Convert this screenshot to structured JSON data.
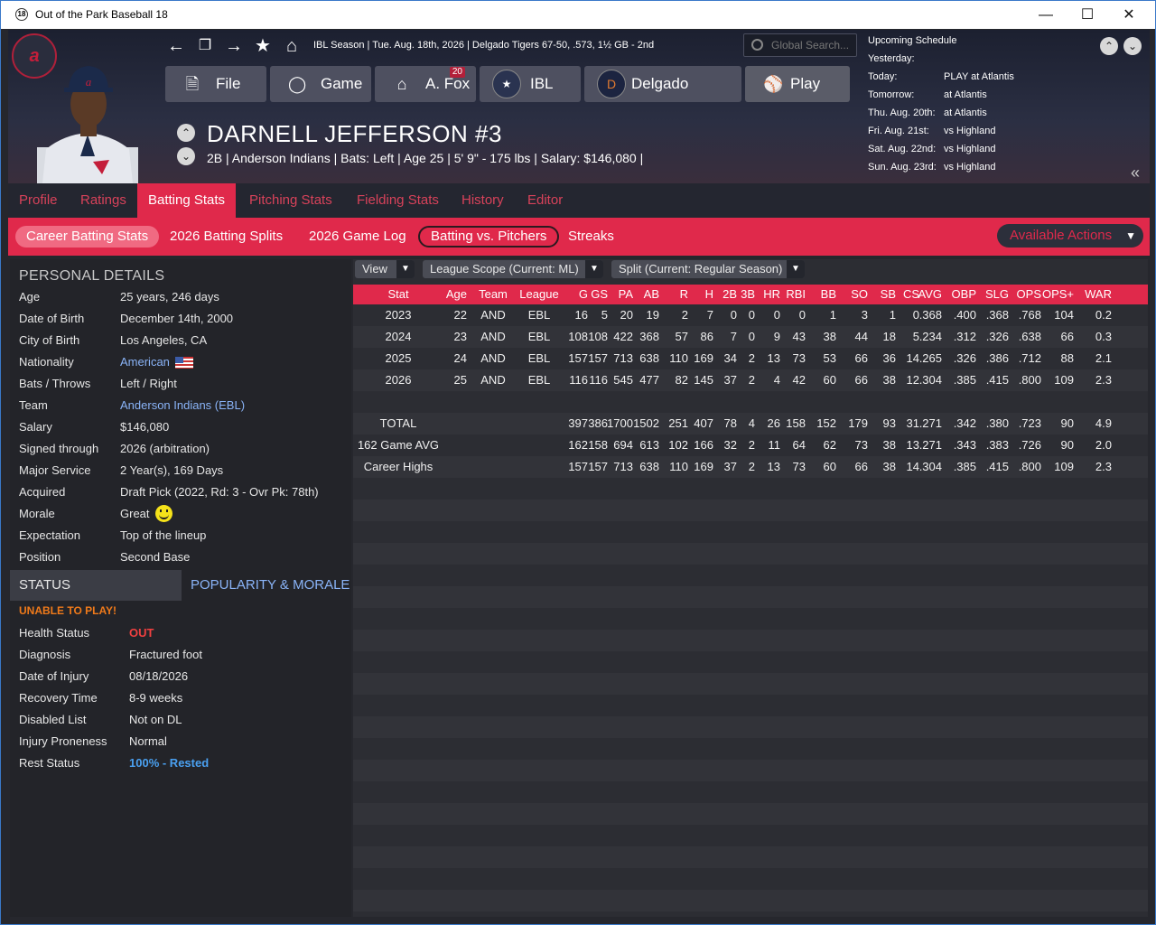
{
  "window": {
    "title": "Out of the Park Baseball 18",
    "icon_text": "18"
  },
  "header": {
    "team_logo": "a",
    "season_info": "IBL Season  |  Tue. Aug. 18th, 2026  |  Delgado Tigers   67-50, .573, 1½ GB - 2nd",
    "search_placeholder": "Global Search...",
    "menu": {
      "file": "File",
      "game": "Game",
      "manager": "A. Fox",
      "manager_badge": "20",
      "league": "IBL",
      "team": "Delgado",
      "play": "Play"
    },
    "player_name": "DARNELL JEFFERSON  #3",
    "player_info": "2B | Anderson Indians  |  Bats: Left  |  Age 25  |  5' 9\" - 175 lbs  |  Salary: $146,080  |"
  },
  "schedule": {
    "title": "Upcoming Schedule",
    "rows": [
      {
        "day": "Yesterday:",
        "opp": ""
      },
      {
        "day": "Today:",
        "opp": "PLAY at Atlantis"
      },
      {
        "day": "Tomorrow:",
        "opp": "at Atlantis"
      },
      {
        "day": "Thu. Aug. 20th:",
        "opp": "at Atlantis"
      },
      {
        "day": "Fri. Aug. 21st:",
        "opp": "vs Highland"
      },
      {
        "day": "Sat. Aug. 22nd:",
        "opp": "vs Highland"
      },
      {
        "day": "Sun. Aug. 23rd:",
        "opp": "vs Highland"
      }
    ]
  },
  "tabs": [
    "Profile",
    "Ratings",
    "Batting Stats",
    "Pitching Stats",
    "Fielding Stats",
    "History",
    "Editor"
  ],
  "subtabs": [
    "Career Batting Stats",
    "2026 Batting Splits",
    "2026 Game Log",
    "Batting vs. Pitchers",
    "Streaks"
  ],
  "available_actions": "Available Actions",
  "personal": {
    "title": "PERSONAL DETAILS",
    "rows": [
      {
        "k": "Age",
        "v": "25 years, 246 days"
      },
      {
        "k": "Date of Birth",
        "v": "December 14th, 2000"
      },
      {
        "k": "City of Birth",
        "v": "Los Angeles, CA"
      },
      {
        "k": "Nationality",
        "v": "American"
      },
      {
        "k": "Bats / Throws",
        "v": "Left / Right"
      },
      {
        "k": "Team",
        "v": "Anderson Indians (EBL)"
      },
      {
        "k": "Salary",
        "v": "$146,080"
      },
      {
        "k": "Signed through",
        "v": "2026 (arbitration)"
      },
      {
        "k": "Major Service",
        "v": "2 Year(s), 169 Days"
      },
      {
        "k": "Acquired",
        "v": "Draft Pick (2022, Rd: 3 - Ovr Pk: 78th)"
      },
      {
        "k": "Morale",
        "v": "Great"
      },
      {
        "k": "Expectation",
        "v": "Top of the lineup"
      },
      {
        "k": "Position",
        "v": "Second Base"
      }
    ]
  },
  "status": {
    "tab_status": "STATUS",
    "tab_popularity": "POPULARITY & MORALE",
    "alert": "UNABLE TO PLAY!",
    "rows": [
      {
        "k": "Health Status",
        "v": "OUT"
      },
      {
        "k": "Diagnosis",
        "v": "Fractured foot"
      },
      {
        "k": "Date of Injury",
        "v": "08/18/2026"
      },
      {
        "k": "Recovery Time",
        "v": "8-9 weeks"
      },
      {
        "k": "Disabled List",
        "v": "Not on DL"
      },
      {
        "k": "Injury Proneness",
        "v": "Normal"
      },
      {
        "k": "Rest Status",
        "v": "100% - Rested"
      }
    ]
  },
  "filters": {
    "view": "View",
    "scope": "League Scope  (Current: ML)",
    "split": "Split  (Current: Regular Season)"
  },
  "stats": {
    "columns": [
      "Stat",
      "Age",
      "Team",
      "League",
      "G",
      "GS",
      "PA",
      "AB",
      "R",
      "H",
      "2B",
      "3B",
      "HR",
      "RBI",
      "BB",
      "SO",
      "SB",
      "CS",
      "AVG",
      "OBP",
      "SLG",
      "OPS",
      "OPS+",
      "WAR"
    ],
    "rows": [
      [
        "2023",
        "22",
        "AND",
        "EBL",
        "16",
        "5",
        "20",
        "19",
        "2",
        "7",
        "0",
        "0",
        "0",
        "0",
        "1",
        "3",
        "1",
        "0",
        ".368",
        ".400",
        ".368",
        ".768",
        "104",
        "0.2"
      ],
      [
        "2024",
        "23",
        "AND",
        "EBL",
        "108",
        "108",
        "422",
        "368",
        "57",
        "86",
        "7",
        "0",
        "9",
        "43",
        "38",
        "44",
        "18",
        "5",
        ".234",
        ".312",
        ".326",
        ".638",
        "66",
        "0.3"
      ],
      [
        "2025",
        "24",
        "AND",
        "EBL",
        "157",
        "157",
        "713",
        "638",
        "110",
        "169",
        "34",
        "2",
        "13",
        "73",
        "53",
        "66",
        "36",
        "14",
        ".265",
        ".326",
        ".386",
        ".712",
        "88",
        "2.1"
      ],
      [
        "2026",
        "25",
        "AND",
        "EBL",
        "116",
        "116",
        "545",
        "477",
        "82",
        "145",
        "37",
        "2",
        "4",
        "42",
        "60",
        "66",
        "38",
        "12",
        ".304",
        ".385",
        ".415",
        ".800",
        "109",
        "2.3"
      ],
      [
        "",
        "",
        "",
        "",
        "",
        "",
        "",
        "",
        "",
        "",
        "",
        "",
        "",
        "",
        "",
        "",
        "",
        "",
        "",
        "",
        "",
        "",
        "",
        ""
      ],
      [
        "TOTAL",
        "",
        "",
        "",
        "397",
        "386",
        "1700",
        "1502",
        "251",
        "407",
        "78",
        "4",
        "26",
        "158",
        "152",
        "179",
        "93",
        "31",
        ".271",
        ".342",
        ".380",
        ".723",
        "90",
        "4.9"
      ],
      [
        "162 Game AVG",
        "",
        "",
        "",
        "162",
        "158",
        "694",
        "613",
        "102",
        "166",
        "32",
        "2",
        "11",
        "64",
        "62",
        "73",
        "38",
        "13",
        ".271",
        ".343",
        ".383",
        ".726",
        "90",
        "2.0"
      ],
      [
        "Career Highs",
        "",
        "",
        "",
        "157",
        "157",
        "713",
        "638",
        "110",
        "169",
        "37",
        "2",
        "13",
        "73",
        "60",
        "66",
        "38",
        "14",
        ".304",
        ".385",
        ".415",
        ".800",
        "109",
        "2.3"
      ]
    ]
  }
}
